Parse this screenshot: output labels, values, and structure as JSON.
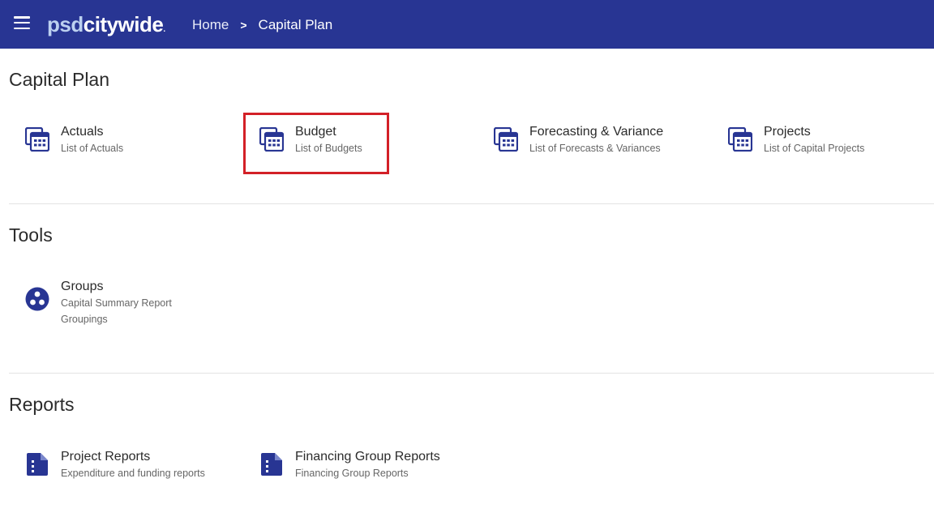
{
  "header": {
    "logo_psd": "psd",
    "logo_citywide": "citywide",
    "logo_dot": ".",
    "breadcrumb_home": "Home",
    "breadcrumb_sep": ">",
    "breadcrumb_current": "Capital Plan"
  },
  "sections": {
    "capital_plan": {
      "title": "Capital Plan",
      "items": [
        {
          "title": "Actuals",
          "sub": "List of Actuals",
          "icon": "table-stack-icon"
        },
        {
          "title": "Budget",
          "sub": "List of Budgets",
          "icon": "table-stack-icon"
        },
        {
          "title": "Forecasting & Variance",
          "sub": "List of Forecasts & Variances",
          "icon": "table-stack-icon"
        },
        {
          "title": "Projects",
          "sub": "List of Capital Projects",
          "icon": "table-stack-icon"
        }
      ]
    },
    "tools": {
      "title": "Tools",
      "items": [
        {
          "title": "Groups",
          "sub": "Capital Summary Report",
          "sub2": "Groupings",
          "icon": "groups-icon"
        }
      ]
    },
    "reports": {
      "title": "Reports",
      "items": [
        {
          "title": "Project Reports",
          "sub": "Expenditure and funding reports",
          "icon": "report-icon"
        },
        {
          "title": "Financing Group Reports",
          "sub": "Financing Group Reports",
          "icon": "report-icon"
        }
      ]
    }
  },
  "colors": {
    "header_bg": "#283593",
    "icon": "#283593",
    "highlight": "#d32027"
  }
}
